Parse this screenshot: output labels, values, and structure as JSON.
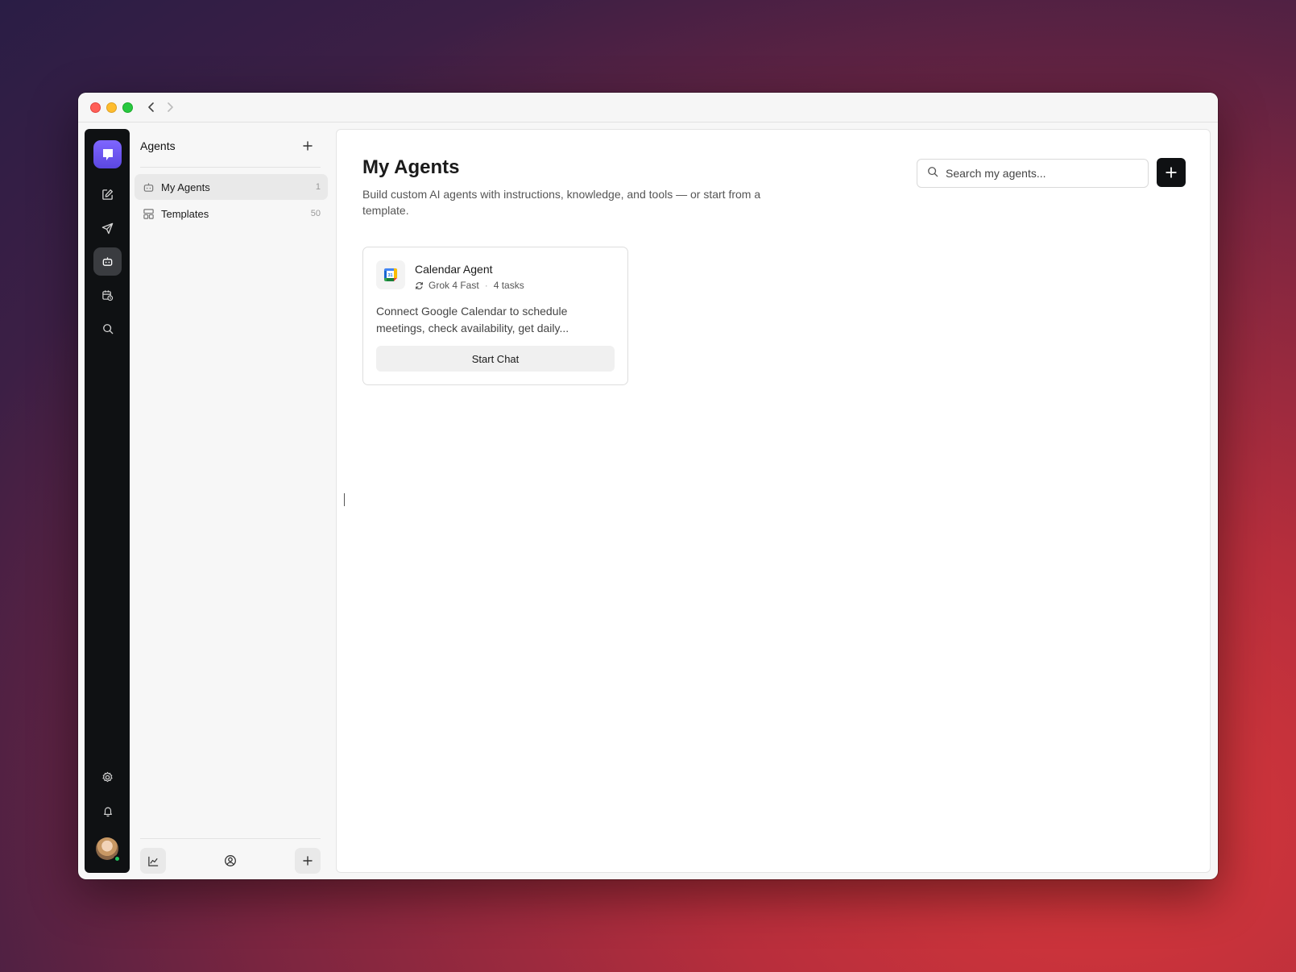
{
  "window": {
    "traffic": [
      "close",
      "minimize",
      "zoom"
    ]
  },
  "rail": {
    "icons": [
      "app-logo-icon",
      "compose-icon",
      "send-icon",
      "bot-icon",
      "schedule-icon",
      "search-icon",
      "gear-icon",
      "bell-icon"
    ],
    "active": "bot-icon",
    "status_color": "#22c55e",
    "logo_color": "#6b55f0"
  },
  "sidebar": {
    "title": "Agents",
    "items": [
      {
        "label": "My Agents",
        "count": "1",
        "icon": "bot-icon",
        "active": true
      },
      {
        "label": "Templates",
        "count": "50",
        "icon": "layout-icon",
        "active": false
      }
    ]
  },
  "main": {
    "title": "My Agents",
    "subtitle": "Build custom AI agents with instructions, knowledge, and tools — or start from a template.",
    "search": {
      "placeholder": "Search my agents..."
    },
    "cards": [
      {
        "title": "Calendar Agent",
        "model": "Grok 4 Fast",
        "tasks": "4 tasks",
        "description": "Connect Google Calendar to schedule meetings, check availability, get daily...",
        "button": "Start Chat",
        "icon": "google-calendar-icon"
      }
    ]
  }
}
